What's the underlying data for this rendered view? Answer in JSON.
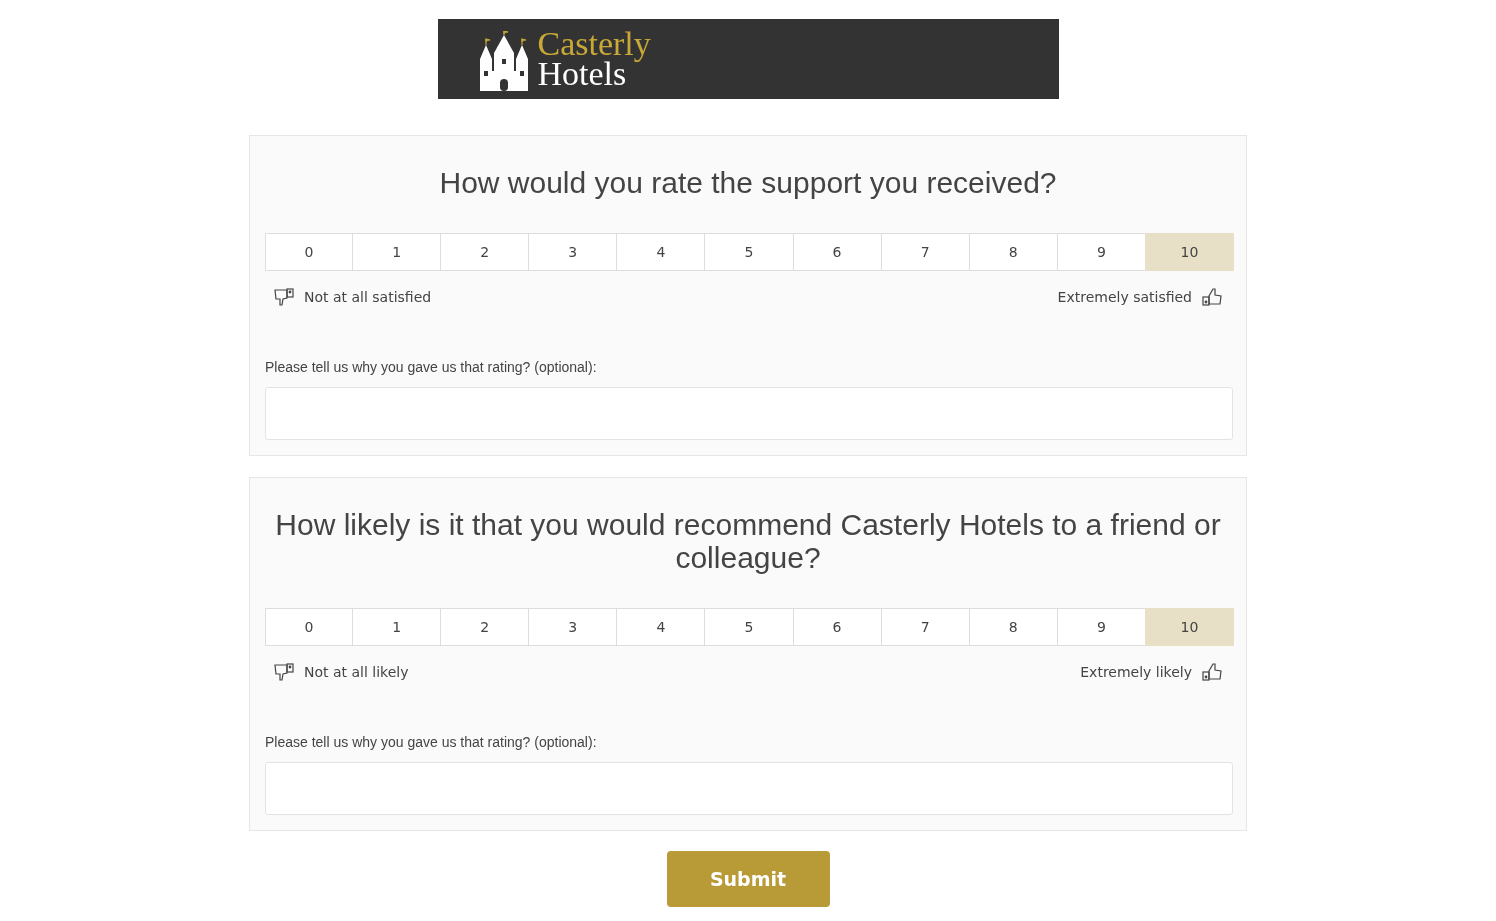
{
  "logo": {
    "line_1": "Casterly",
    "line_2": "Hotels"
  },
  "questions": [
    {
      "title": "How would you rate the support you received?",
      "scale": [
        {
          "label": "0",
          "selected": false
        },
        {
          "label": "1",
          "selected": false
        },
        {
          "label": "2",
          "selected": false
        },
        {
          "label": "3",
          "selected": false
        },
        {
          "label": "4",
          "selected": false
        },
        {
          "label": "5",
          "selected": false
        },
        {
          "label": "6",
          "selected": false
        },
        {
          "label": "7",
          "selected": false
        },
        {
          "label": "8",
          "selected": false
        },
        {
          "label": "9",
          "selected": false
        },
        {
          "label": "10",
          "selected": true
        }
      ],
      "low_label": "Not at all satisfied",
      "high_label": "Extremely satisfied",
      "comment_label": "Please tell us why you gave us that rating? (optional):"
    },
    {
      "title": "How likely is it that you would recommend Casterly Hotels to a friend or colleague?",
      "scale": [
        {
          "label": "0",
          "selected": false
        },
        {
          "label": "1",
          "selected": false
        },
        {
          "label": "2",
          "selected": false
        },
        {
          "label": "3",
          "selected": false
        },
        {
          "label": "4",
          "selected": false
        },
        {
          "label": "5",
          "selected": false
        },
        {
          "label": "6",
          "selected": false
        },
        {
          "label": "7",
          "selected": false
        },
        {
          "label": "8",
          "selected": false
        },
        {
          "label": "9",
          "selected": false
        },
        {
          "label": "10",
          "selected": true
        }
      ],
      "low_label": "Not at all likely",
      "high_label": "Extremely likely",
      "comment_label": "Please tell us why you gave us that rating? (optional):"
    }
  ],
  "submit": "Submit"
}
